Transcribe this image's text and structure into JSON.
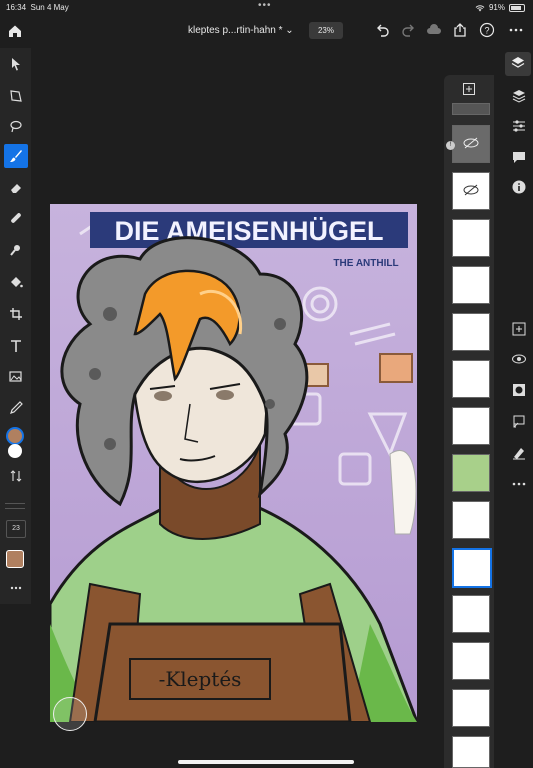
{
  "status": {
    "time": "16:34",
    "date": "Sun 4 May",
    "battery": "91%"
  },
  "header": {
    "doc_title": "kleptes p...rtin-hahn *",
    "zoom": "23%"
  },
  "tools": {
    "brush_size": "23"
  },
  "artwork": {
    "title": "DIE AMEISENHÜGEL",
    "subtitle": "THE ANTHILL",
    "nametag": "-Kleptés"
  },
  "layers": {
    "count": 14,
    "selected_index": 10
  },
  "colors": {
    "accent": "#1473e6",
    "foreground": "#b08060",
    "background": "#ffffff",
    "panel": "#262626"
  }
}
